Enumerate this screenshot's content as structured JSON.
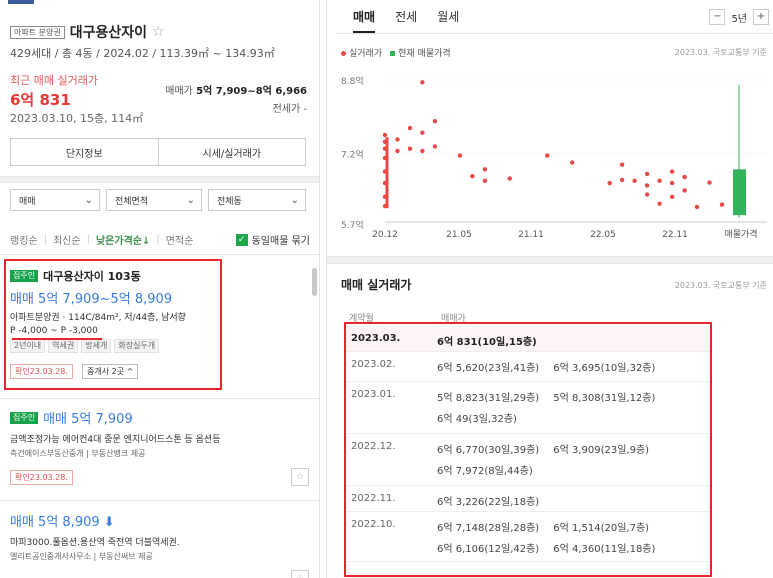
{
  "left": {
    "badge": "아파트 분양권",
    "title": "대구용산자이",
    "star": "☆",
    "info": "429세대 / 총 4동 / 2024.02 / 113.39㎡ ~ 134.93㎡",
    "recent_label": "최근 매매 실거래가",
    "recent_price": "6억 831",
    "recent_date": "2023.03.10, 15층, 114㎡",
    "sale_range_label": "매매가",
    "sale_range_value": "5억 7,909~8억 6,966",
    "jeonse": "전세가 -",
    "buttons": [
      "단지정보",
      "시세/실거래가"
    ],
    "filters": [
      "매매",
      "전체면적",
      "전체동"
    ],
    "sort": [
      "랭킹순",
      "최신순",
      "낮은가격순↓",
      "면적순"
    ],
    "same_listing": "동일매물 묶기",
    "listings": [
      {
        "badge": "집주인",
        "title": "대구용산자이 103동",
        "price": "매매 5억 7,909~5억 8,909",
        "line": "아파트분양권 · 114C/84m², 저/44층, 남서향",
        "premium": "P -4,000 ~ P -3,000",
        "tags": [
          "2년이내",
          "역세권",
          "방세개",
          "화장실두개"
        ],
        "confirm": "확인23.03.28.",
        "broker": "중개사 2곳 ^"
      },
      {
        "badge": "집주인",
        "price": "매매 5억 7,909",
        "line": "금액조정가능 에어컨4대 중문 엔지니어드스톤 등 옵션등",
        "sub": "측건에이스부동산중개 | 부동산뱅크 제공",
        "confirm": "확인23.03.28."
      },
      {
        "price": "매매 5억 8,909 ⬇",
        "line": "마피3000.풀옵션.용산역 죽전역 더블역세권.",
        "sub": "엘리트공인중개사사무소 | 부동산써브 제공"
      }
    ]
  },
  "right": {
    "tabs": [
      "매매",
      "전세",
      "월세"
    ],
    "year_minus": "−",
    "year": "5년",
    "year_plus": "+",
    "legend_actual": "실거래가",
    "legend_current": "현재 매물가격",
    "source": "2023.03. 국토교통부 기준",
    "section_title": "매매 실거래가",
    "section_source": "2023.03. 국토교통부 기준",
    "col_date": "계약월",
    "col_price": "매매가",
    "transactions": [
      {
        "month": "2023.03.",
        "deals": [
          "6억 831(10일,15층)"
        ]
      },
      {
        "month": "2023.02.",
        "deals": [
          "6억 5,620(23일,41층)",
          "6억 3,695(10일,32층)"
        ]
      },
      {
        "month": "2023.01.",
        "deals": [
          "5억 8,823(31일,29층)",
          "5억 8,308(31일,12층)",
          "6억 49(3일,32층)"
        ]
      },
      {
        "month": "2022.12.",
        "deals": [
          "6억 6,770(30일,39층)",
          "6억 3,909(23일,9층)",
          "6억 7,972(8일,44층)"
        ]
      },
      {
        "month": "2022.11.",
        "deals": [
          "6억 3,226(22일,18층)"
        ]
      },
      {
        "month": "2022.10.",
        "deals": [
          "6억 7,148(28일,28층)",
          "6억 1,514(20일,7층)",
          "6억 6,106(12일,42층)",
          "6억 4,360(11일,18층)"
        ]
      }
    ]
  },
  "chart_data": {
    "type": "scatter",
    "yticks": [
      "8.8억",
      "7.2억",
      "5.7억"
    ],
    "yvalues": [
      8.8,
      7.2,
      5.7
    ],
    "xticks": [
      "20.12",
      "21.05",
      "21.11",
      "22.05",
      "22.11",
      "매물가격"
    ],
    "series": [
      {
        "name": "실거래가",
        "x": [
          "2020.12",
          "2020.12",
          "2020.12",
          "2020.12",
          "2020.12",
          "2020.12",
          "2020.12",
          "2020.12",
          "2021.01",
          "2021.01",
          "2021.02",
          "2021.02",
          "2021.03",
          "2021.03",
          "2021.03",
          "2021.04",
          "2021.04",
          "2021.06",
          "2021.07",
          "2021.08",
          "2021.08",
          "2021.10",
          "2022.01",
          "2022.03",
          "2022.06",
          "2022.07",
          "2022.07",
          "2022.08",
          "2022.09",
          "2022.09",
          "2022.09",
          "2022.10",
          "2022.10",
          "2022.11",
          "2022.11",
          "2022.11",
          "2022.12",
          "2022.12",
          "2023.01",
          "2023.02",
          "2023.03"
        ],
        "y": [
          7.6,
          7.45,
          7.3,
          7.1,
          6.8,
          6.55,
          6.25,
          6.05,
          7.5,
          7.25,
          7.3,
          7.75,
          8.75,
          7.65,
          7.25,
          7.9,
          7.35,
          7.15,
          6.7,
          6.6,
          6.85,
          6.65,
          7.15,
          7.0,
          6.55,
          6.62,
          6.95,
          6.6,
          6.5,
          6.75,
          6.3,
          6.6,
          6.1,
          6.55,
          6.8,
          6.25,
          6.68,
          6.39,
          6.03,
          6.56,
          6.08
        ]
      },
      {
        "name": "현재 매물가격",
        "range": [
          5.79,
          8.7
        ],
        "box": [
          5.85,
          6.85
        ]
      }
    ],
    "ylim": [
      5.7,
      8.8
    ]
  }
}
